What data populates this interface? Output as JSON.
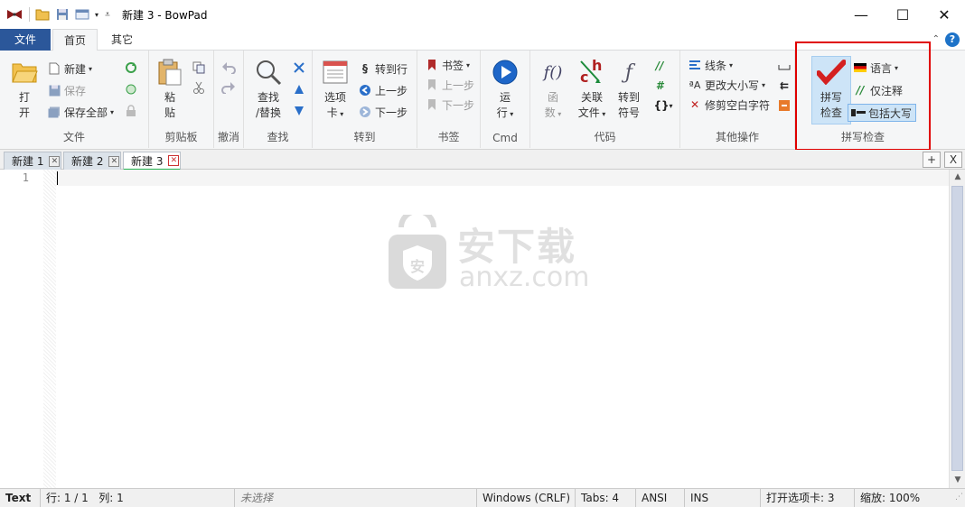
{
  "window": {
    "title": "新建 3 - BowPad"
  },
  "ribbon_tabs": {
    "file": "文件",
    "home": "首页",
    "other": "其它",
    "help": "?"
  },
  "groups": {
    "file": {
      "title": "文件",
      "open": "打\n开",
      "new": "新建",
      "save": "保存",
      "save_all": "保存全部"
    },
    "clipboard": {
      "title": "剪贴板",
      "paste": "粘\n贴"
    },
    "undo": {
      "title": "撤消"
    },
    "find": {
      "title": "查找",
      "find_replace": "查找\n/替换"
    },
    "goto": {
      "title": "转到",
      "options_tab": "选项\n卡",
      "goto_line": "转到行",
      "prev": "上一步",
      "next": "下一步"
    },
    "bookmarks": {
      "title": "书签",
      "bookmark": "书签",
      "prev": "上一步",
      "next": "下一步"
    },
    "cmd": {
      "title": "Cmd",
      "run": "运\n行"
    },
    "code": {
      "title": "代码",
      "functions": "函\n数",
      "related_files": "关联\n文件",
      "goto_symbol": "转到\n符号"
    },
    "other_ops": {
      "title": "其他操作",
      "lines": "线条",
      "change_case": "更改大小写",
      "trim_whitespace": "修剪空白字符"
    },
    "spellcheck": {
      "title": "拼写检查",
      "spellcheck": "拼写\n检查",
      "language": "语言",
      "comments_only": "仅注释",
      "include_uppercase": "包括大写"
    }
  },
  "doc_tabs": [
    "新建 1",
    "新建 2",
    "新建 3"
  ],
  "active_tab": 2,
  "tab_buttons": {
    "add": "+",
    "close": "X"
  },
  "editor": {
    "line_numbers": [
      "1"
    ]
  },
  "watermark": {
    "cn": "安下载",
    "en": "anxz.com",
    "shield_char": "安"
  },
  "status": {
    "lexer": "Text",
    "position": "行: 1 / 1   列: 1",
    "selection": "未选择",
    "eol": "Windows (CRLF)",
    "tabs": "Tabs: 4",
    "encoding": "ANSI",
    "mode": "INS",
    "open_tabs": "打开选项卡: 3",
    "zoom": "缩放: 100%"
  },
  "colors": {
    "file_tab": "#2b579a",
    "highlight": "#e00000",
    "active_tab_line": "#23b14d"
  }
}
